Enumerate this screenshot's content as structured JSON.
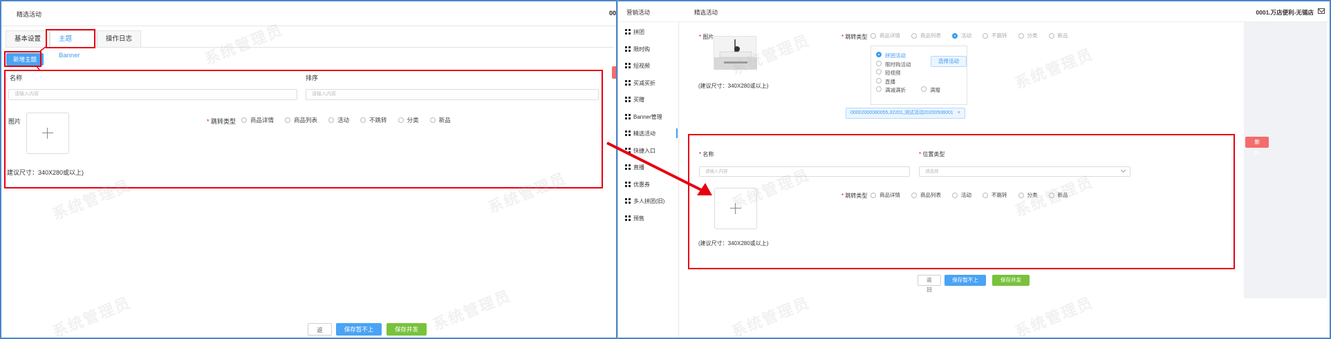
{
  "left": {
    "page_title": "精选活动",
    "shop_name": "00",
    "tabs": [
      "基本设置",
      "主题Banner",
      "操作日志"
    ],
    "new_button": "新增主题",
    "name_label": "名称",
    "sort_label": "排序",
    "name_placeholder": "请输入内容",
    "sort_placeholder": "请输入内容",
    "image_label": "图片",
    "jump_label": "跳转类型",
    "jump_options": [
      "商品详情",
      "商品列表",
      "活动",
      "不跳转",
      "分类",
      "新品"
    ],
    "size_hint": "建议尺寸：340X280或以上)",
    "buttons": {
      "back": "返回",
      "save_offline": "保存暂不上架",
      "save_publish": "保存并发布"
    },
    "watermark": "系统管理员"
  },
  "right": {
    "menu_title": "营销活动",
    "page_title": "精选活动",
    "shop_name": "0001.万店便利-无锡店",
    "sidebar": [
      "拼团",
      "限时购",
      "短视频",
      "买减买折",
      "买赠",
      "Banner管理",
      "精选活动",
      "快捷入口",
      "直播",
      "优惠券",
      "多人拼团(旧)",
      "预售"
    ],
    "top": {
      "image_label": "图片",
      "jump_label": "跳转类型",
      "jump_partial": [
        "商品详情",
        "商品列表",
        "活动",
        "不跳转",
        "分类",
        "新品"
      ],
      "activity_options": [
        "拼团活动",
        "限时购活动",
        "短视频",
        "直播",
        "满减满折",
        "满赠"
      ],
      "select_activity": "选择活动",
      "selected_tag": "00002000080055,32201,测试活动20200508001",
      "size_hint": "(建议尺寸：340X280或以上)"
    },
    "form": {
      "name_label": "名称",
      "position_label": "位置类型",
      "name_placeholder": "请输入内容",
      "position_placeholder": "请选择",
      "jump_label": "跳转类型",
      "jump_options": [
        "商品详情",
        "商品列表",
        "活动",
        "不跳转",
        "分类",
        "新品"
      ],
      "size_hint": "(建议尺寸：340X280或以上)"
    },
    "delete_button": "删除",
    "buttons": {
      "back": "返回",
      "save_offline": "保存暂不上架",
      "save_publish": "保存并发布"
    },
    "watermark": "系统管理员"
  },
  "colors": {
    "annotation_red": "#e60012",
    "primary_blue": "#4aa3f5",
    "success_green": "#78c23c",
    "danger": "#f56c6c"
  }
}
